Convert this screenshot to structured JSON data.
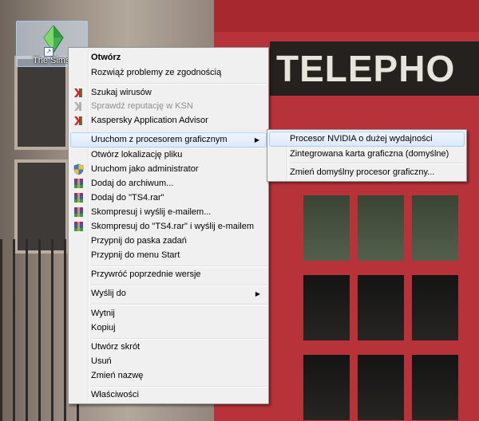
{
  "desktop": {
    "icon_label": "The Sims 4",
    "booth_sign": "TELEPHO"
  },
  "context_menu": {
    "items": [
      {
        "label": "Otwórz",
        "bold": true,
        "icon": null
      },
      {
        "label": "Rozwiąż problemy ze zgodnością",
        "icon": null
      },
      {
        "label": "Szukaj wirusów",
        "icon": "kaspersky-icon"
      },
      {
        "label": "Sprawdź reputację w KSN",
        "icon": "kaspersky-icon",
        "disabled": true
      },
      {
        "label": "Kaspersky Application Advisor",
        "icon": "kaspersky-icon"
      },
      {
        "label": "Uruchom z procesorem graficznym",
        "icon": null,
        "submenu": true,
        "highlighted": true
      },
      {
        "label": "Otwórz lokalizację pliku",
        "icon": null
      },
      {
        "label": "Uruchom jako administrator",
        "icon": "uac-shield-icon"
      },
      {
        "label": "Dodaj do archiwum...",
        "icon": "winrar-icon"
      },
      {
        "label": "Dodaj do \"TS4.rar\"",
        "icon": "winrar-icon"
      },
      {
        "label": "Skompresuj i wyślij e-mailem...",
        "icon": "winrar-icon"
      },
      {
        "label": "Skompresuj do \"TS4.rar\" i wyślij e-mailem",
        "icon": "winrar-icon"
      },
      {
        "label": "Przypnij do paska zadań",
        "icon": null
      },
      {
        "label": "Przypnij do menu Start",
        "icon": null
      },
      {
        "label": "Przywróć poprzednie wersje",
        "icon": null
      },
      {
        "label": "Wyślij do",
        "icon": null,
        "submenu": true
      },
      {
        "label": "Wytnij",
        "icon": null
      },
      {
        "label": "Kopiuj",
        "icon": null
      },
      {
        "label": "Utwórz skrót",
        "icon": null
      },
      {
        "label": "Usuń",
        "icon": null
      },
      {
        "label": "Zmień nazwę",
        "icon": null
      },
      {
        "label": "Właściwości",
        "icon": null
      }
    ]
  },
  "gpu_submenu": {
    "items": [
      {
        "label": "Procesor NVIDIA o dużej wydajności",
        "highlighted": true
      },
      {
        "label": "Zintegrowana karta graficzna (domyślne)"
      },
      {
        "label": "Zmień domyślny procesor graficzny..."
      }
    ]
  },
  "colors": {
    "menu_background": "#f0f0f0",
    "highlight_border": "#aecff7",
    "booth_red": "#b8323a"
  }
}
